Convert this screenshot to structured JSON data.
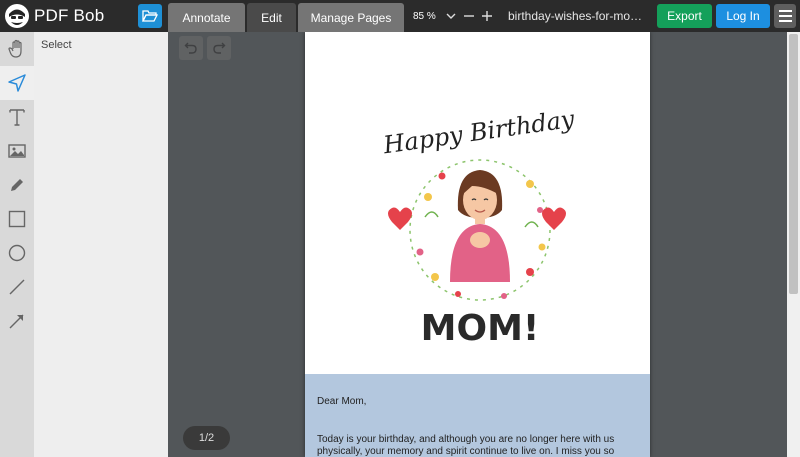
{
  "app": {
    "name": "PDF Bob"
  },
  "toolbar": {
    "open_icon": "folder-open-icon",
    "tabs": [
      {
        "label": "Annotate",
        "active": false
      },
      {
        "label": "Edit",
        "active": true
      },
      {
        "label": "Manage Pages",
        "active": false
      }
    ],
    "zoom": {
      "value": "85 %",
      "options_icon": "chevron-down-icon",
      "zoom_out_icon": "minus-icon",
      "zoom_in_icon": "plus-icon"
    },
    "filename": "birthday-wishes-for-mom...",
    "export_label": "Export",
    "login_label": "Log In",
    "menu_icon": "hamburger-menu-icon"
  },
  "tools": [
    {
      "name": "hand-icon",
      "active": false
    },
    {
      "name": "select-arrow-icon",
      "active": true
    },
    {
      "name": "text-icon",
      "active": false
    },
    {
      "name": "image-icon",
      "active": false
    },
    {
      "name": "pencil-icon",
      "active": false
    },
    {
      "name": "rectangle-icon",
      "active": false
    },
    {
      "name": "circle-icon",
      "active": false
    },
    {
      "name": "line-icon",
      "active": false
    },
    {
      "name": "arrow-icon",
      "active": false
    }
  ],
  "panel": {
    "label": "Select"
  },
  "viewer": {
    "undo_icon": "undo-icon",
    "redo_icon": "redo-icon",
    "page_indicator": "1/2"
  },
  "document": {
    "art_headline": "Happy Birthday",
    "art_mom": "MOM!",
    "greeting": "Dear Mom,",
    "body": "Today is your birthday, and although you are no longer here with us physically, your memory and spirit continue to live on.  I miss you so much"
  },
  "colors": {
    "topbar": "#2b2b2b",
    "open_button": "#1e90d6",
    "export_button": "#14a05a",
    "login_button": "#1d8fe0",
    "viewer_bg": "#525659",
    "letter_bg": "#b3c7de",
    "heart": "#e5424b",
    "sweater": "#e26287"
  }
}
